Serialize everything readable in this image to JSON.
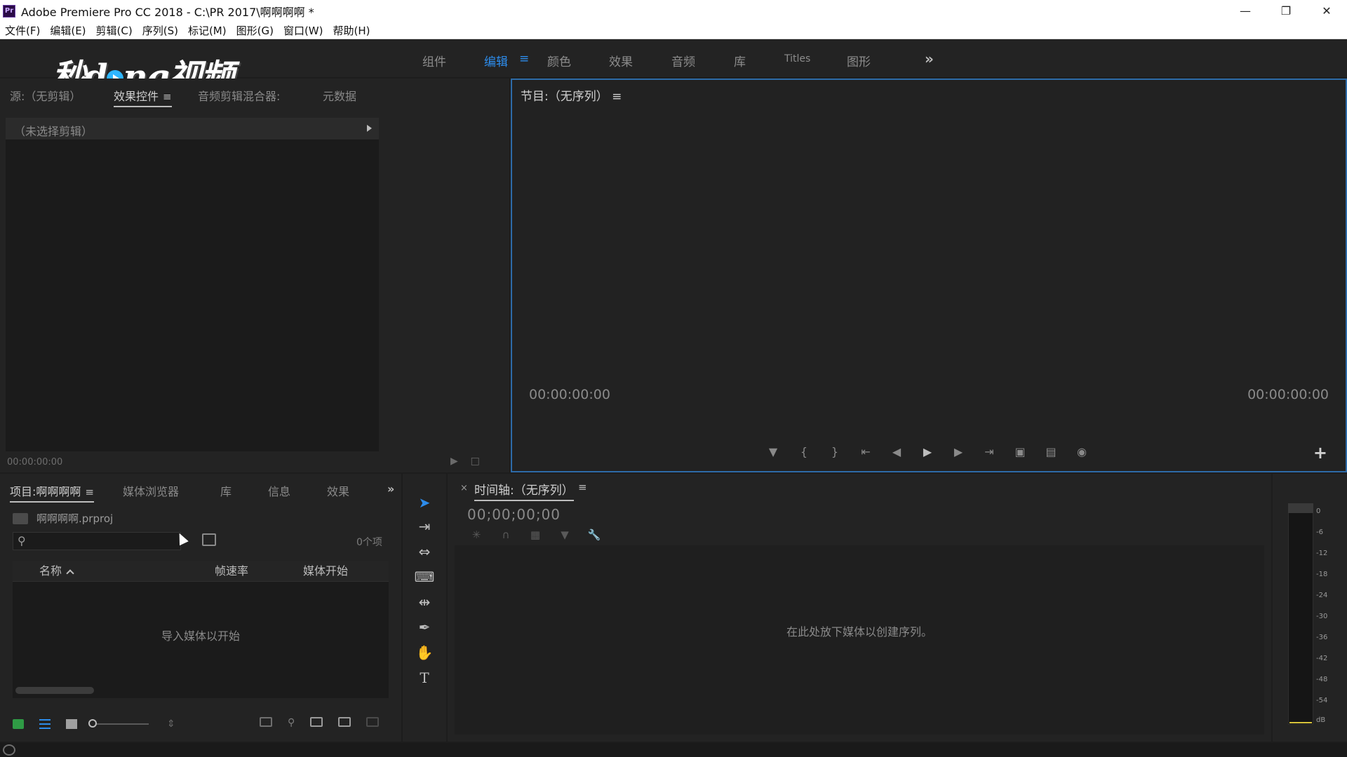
{
  "window": {
    "app_icon": "Pr",
    "title": "Adobe Premiere Pro CC 2018 - C:\\PR 2017\\啊啊啊啊 *",
    "controls": [
      "minimize-icon",
      "restore-icon",
      "close-icon"
    ]
  },
  "menu": {
    "items": [
      "文件(F)",
      "编辑(E)",
      "剪辑(C)",
      "序列(S)",
      "标记(M)",
      "图形(G)",
      "窗口(W)",
      "帮助(H)"
    ]
  },
  "workspaces": {
    "tabs": [
      "组件",
      "编辑",
      "颜色",
      "效果",
      "音频",
      "库",
      "Titles",
      "图形"
    ],
    "active": "编辑",
    "menu_glyph": "≡",
    "more_glyph": "»"
  },
  "logo": {
    "part1": "秒d",
    "part2": "ng视频"
  },
  "effect_panel": {
    "tabs": [
      "源:（无剪辑）",
      "效果控件",
      "音频剪辑混合器:",
      "元数据"
    ],
    "active_tab_label": "效果控件",
    "tab_menu": "≡",
    "header": "（未选择剪辑）",
    "timecode": "00:00:00:00",
    "footer_icons": [
      "filter-icon",
      "export-icon"
    ]
  },
  "program_monitor": {
    "title": "节目:（无序列）",
    "menu_glyph": "≡",
    "timecode_left": "00:00:00:00",
    "timecode_right": "00:00:00:00",
    "transport": [
      "marker-icon",
      "mark-in-icon",
      "mark-out-icon",
      "go-to-in-icon",
      "step-back-icon",
      "play-icon",
      "step-forward-icon",
      "go-to-out-icon",
      "lift-icon",
      "extract-icon",
      "export-frame-icon"
    ],
    "add_button": "+"
  },
  "project_panel": {
    "tabs": [
      "项目:啊啊啊啊",
      "媒体浏览器",
      "库",
      "信息",
      "效果"
    ],
    "active_tab": "项目:啊啊啊啊",
    "tab_menu": "≡",
    "more_glyph": "»",
    "file_name": "啊啊啊啊.prproj",
    "search_placeholder": "",
    "item_count": "0个项",
    "columns": [
      "名称",
      "帧速率",
      "媒体开始"
    ],
    "empty_message": "导入媒体以开始"
  },
  "tools": [
    "selection-tool-icon",
    "track-select-tool-icon",
    "ripple-edit-tool-icon",
    "razor-tool-icon",
    "slip-tool-icon",
    "pen-tool-icon",
    "hand-tool-icon",
    "type-tool-icon"
  ],
  "timeline": {
    "close": "×",
    "title": "时间轴:（无序列）",
    "menu_glyph": "≡",
    "timecode": "00;00;00;00",
    "tool_icons": [
      "nest-icon",
      "snap-icon",
      "linked-selection-icon",
      "add-marker-icon",
      "wrench-icon"
    ],
    "drop_message": "在此处放下媒体以创建序列。"
  },
  "audio_meter": {
    "scale": [
      "0",
      "-6",
      "-12",
      "-18",
      "-24",
      "-30",
      "-36",
      "-42",
      "-48",
      "-54",
      "dB"
    ],
    "level_color": "#d7c33a"
  },
  "colors": {
    "accent_blue": "#2d8ceb",
    "panel_bg": "#232323",
    "app_bg": "#1d1d1d",
    "focus_border": "#2d6ba8"
  }
}
